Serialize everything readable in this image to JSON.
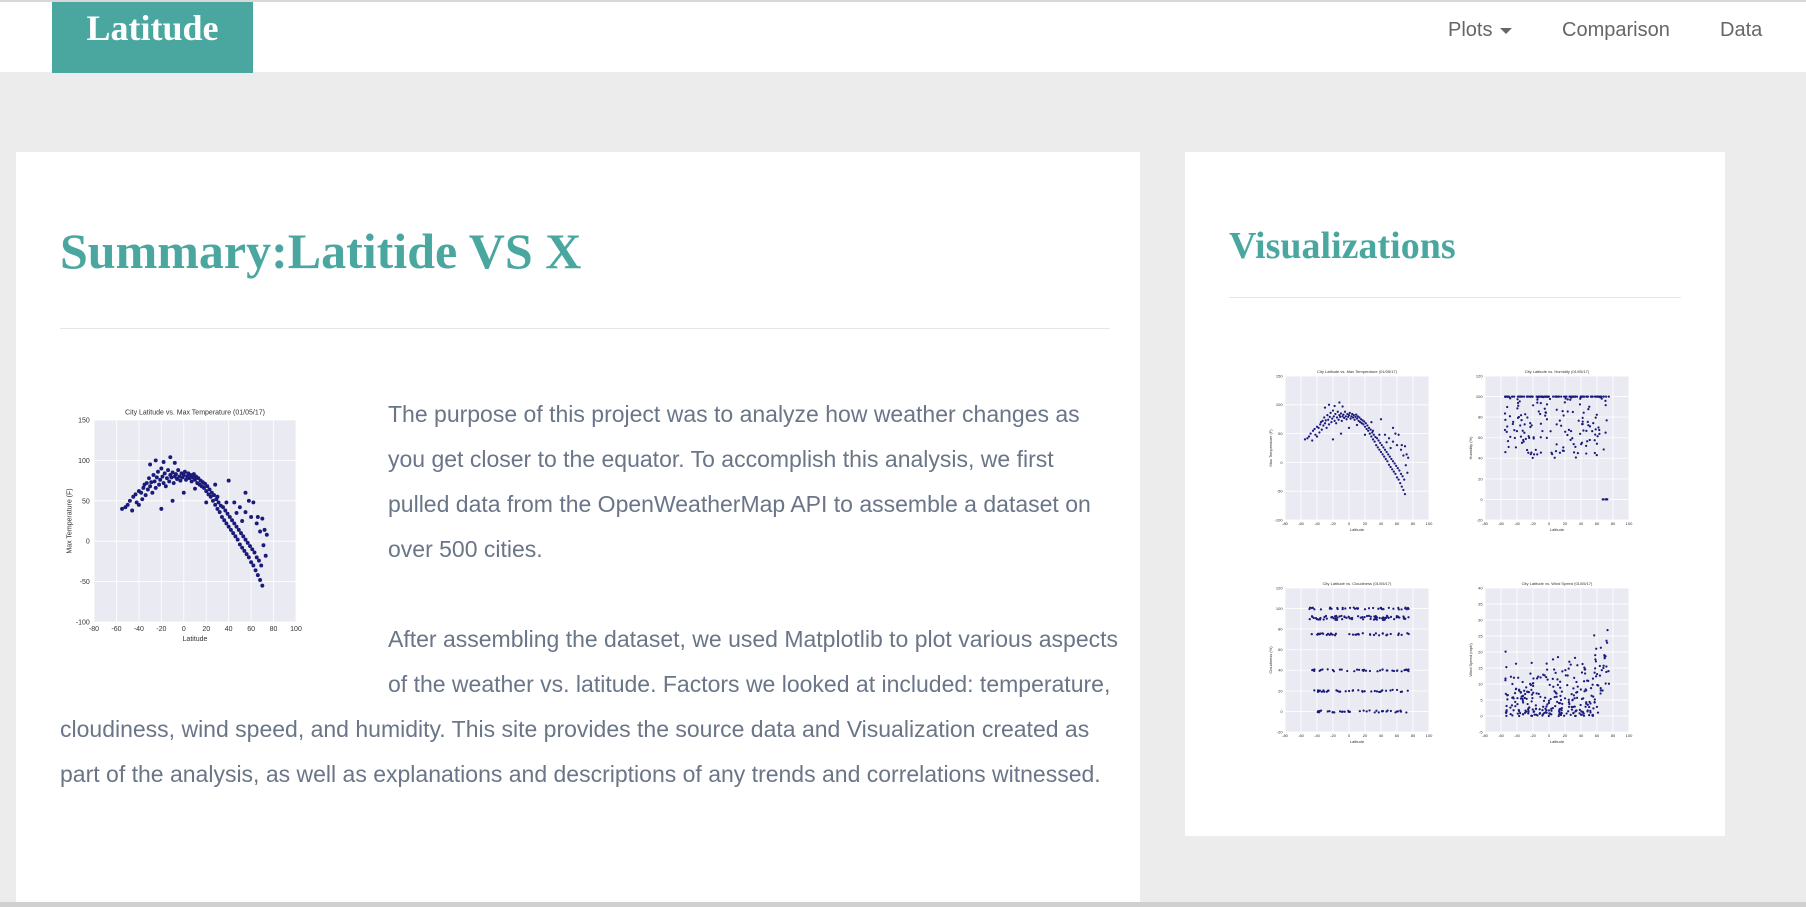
{
  "navbar": {
    "brand": "Latitude",
    "items": [
      {
        "label": "Plots",
        "dropdown": true
      },
      {
        "label": "Comparison"
      },
      {
        "label": "Data"
      }
    ]
  },
  "colors": {
    "accent": "#4aa79f",
    "text": "#6a7587",
    "background": "#ececec",
    "plot_background": "#eaeaf2",
    "point": "#1a1a7a"
  },
  "summary": {
    "title": "Summary:Latitide VS X",
    "paragraph1": "The purpose of this project was to analyze how weather changes as you get closer to the equator. To accomplish this analysis, we first pulled data from the OpenWeatherMap API to assemble a dataset on over 500 cities.",
    "paragraph2": "After assembling the dataset, we used Matplotlib to plot various aspects of the weather vs. latitude. Factors we looked at included: temperature, cloudiness, wind speed, and humidity. This site provides the source data and Visualization created as part of the analysis, as well as explanations and descriptions of any trends and correlations witnessed."
  },
  "sidebar": {
    "title": "Visualizations"
  },
  "chart_data": [
    {
      "type": "scatter",
      "title": "City Latitude vs. Max Temperature (01/05/17)",
      "xlabel": "Latitude",
      "ylabel": "Max Temperature (F)",
      "xlim": [
        -80,
        100
      ],
      "ylim": [
        -100,
        150
      ],
      "xticks": [
        -80,
        -60,
        -40,
        -20,
        0,
        20,
        40,
        60,
        80,
        100
      ],
      "yticks": [
        -100,
        -50,
        0,
        50,
        100,
        150
      ],
      "grid": true,
      "points": [
        [
          -55,
          40
        ],
        [
          -52,
          42
        ],
        [
          -50,
          45
        ],
        [
          -48,
          50
        ],
        [
          -46,
          38
        ],
        [
          -45,
          55
        ],
        [
          -43,
          58
        ],
        [
          -42,
          48
        ],
        [
          -40,
          62
        ],
        [
          -38,
          60
        ],
        [
          -37,
          52
        ],
        [
          -36,
          66
        ],
        [
          -35,
          70
        ],
        [
          -34,
          57
        ],
        [
          -33,
          72
        ],
        [
          -32,
          64
        ],
        [
          -31,
          78
        ],
        [
          -30,
          68
        ],
        [
          -29,
          73
        ],
        [
          -28,
          60
        ],
        [
          -27,
          82
        ],
        [
          -26,
          74
        ],
        [
          -25,
          66
        ],
        [
          -24,
          79
        ],
        [
          -23,
          86
        ],
        [
          -22,
          70
        ],
        [
          -21,
          76
        ],
        [
          -20,
          90
        ],
        [
          -19,
          80
        ],
        [
          -18,
          72
        ],
        [
          -17,
          84
        ],
        [
          -16,
          68
        ],
        [
          -15,
          78
        ],
        [
          -14,
          88
        ],
        [
          -13,
          74
        ],
        [
          -12,
          82
        ],
        [
          -11,
          79
        ],
        [
          -10,
          85
        ],
        [
          -9,
          72
        ],
        [
          -8,
          80
        ],
        [
          -7,
          83
        ],
        [
          -6,
          77
        ],
        [
          -5,
          88
        ],
        [
          -4,
          80
        ],
        [
          -3,
          75
        ],
        [
          -2,
          84
        ],
        [
          -1,
          79
        ],
        [
          0,
          82
        ],
        [
          1,
          86
        ],
        [
          2,
          76
        ],
        [
          3,
          80
        ],
        [
          4,
          84
        ],
        [
          5,
          78
        ],
        [
          6,
          82
        ],
        [
          7,
          74
        ],
        [
          8,
          79
        ],
        [
          9,
          83
        ],
        [
          10,
          76
        ],
        [
          11,
          80
        ],
        [
          12,
          72
        ],
        [
          13,
          78
        ],
        [
          14,
          70
        ],
        [
          15,
          75
        ],
        [
          16,
          68
        ],
        [
          17,
          73
        ],
        [
          18,
          66
        ],
        [
          19,
          71
        ],
        [
          20,
          62
        ],
        [
          21,
          68
        ],
        [
          22,
          58
        ],
        [
          23,
          64
        ],
        [
          24,
          55
        ],
        [
          25,
          60
        ],
        [
          26,
          50
        ],
        [
          27,
          57
        ],
        [
          28,
          45
        ],
        [
          29,
          52
        ],
        [
          30,
          40
        ],
        [
          31,
          48
        ],
        [
          32,
          36
        ],
        [
          33,
          44
        ],
        [
          34,
          30
        ],
        [
          35,
          42
        ],
        [
          36,
          26
        ],
        [
          37,
          38
        ],
        [
          38,
          22
        ],
        [
          39,
          34
        ],
        [
          40,
          18
        ],
        [
          41,
          30
        ],
        [
          42,
          14
        ],
        [
          43,
          26
        ],
        [
          44,
          10
        ],
        [
          45,
          22
        ],
        [
          46,
          6
        ],
        [
          47,
          18
        ],
        [
          48,
          2
        ],
        [
          49,
          14
        ],
        [
          50,
          -4
        ],
        [
          51,
          10
        ],
        [
          52,
          -8
        ],
        [
          53,
          6
        ],
        [
          54,
          -12
        ],
        [
          55,
          2
        ],
        [
          56,
          -16
        ],
        [
          57,
          -2
        ],
        [
          58,
          -20
        ],
        [
          59,
          -6
        ],
        [
          60,
          -26
        ],
        [
          61,
          -10
        ],
        [
          62,
          -30
        ],
        [
          63,
          -14
        ],
        [
          64,
          -36
        ],
        [
          65,
          -20
        ],
        [
          66,
          -42
        ],
        [
          67,
          -24
        ],
        [
          68,
          -48
        ],
        [
          69,
          -30
        ],
        [
          70,
          -55
        ],
        [
          45,
          48
        ],
        [
          50,
          42
        ],
        [
          55,
          36
        ],
        [
          60,
          30
        ],
        [
          65,
          22
        ],
        [
          70,
          28
        ],
        [
          72,
          14
        ],
        [
          74,
          8
        ],
        [
          -40,
          45
        ],
        [
          -30,
          95
        ],
        [
          -25,
          100
        ],
        [
          -18,
          98
        ],
        [
          -12,
          104
        ],
        [
          -8,
          97
        ],
        [
          -20,
          40
        ],
        [
          -10,
          50
        ],
        [
          0,
          60
        ],
        [
          10,
          65
        ],
        [
          20,
          48
        ],
        [
          30,
          55
        ],
        [
          40,
          75
        ],
        [
          55,
          60
        ],
        [
          62,
          48
        ],
        [
          66,
          30
        ],
        [
          68,
          12
        ],
        [
          71,
          -5
        ],
        [
          73,
          -18
        ],
        [
          58,
          50
        ],
        [
          52,
          25
        ],
        [
          47,
          35
        ],
        [
          38,
          48
        ],
        [
          28,
          70
        ]
      ]
    },
    {
      "type": "scatter",
      "title": "City Latitude vs. Max Temperature (01/05/17)",
      "xlabel": "Latitude",
      "ylabel": "Max Temperature (F)",
      "xlim": [
        -80,
        100
      ],
      "ylim": [
        -100,
        150
      ],
      "xticks": [
        -80,
        -60,
        -40,
        -20,
        0,
        20,
        40,
        60,
        80,
        100
      ],
      "yticks": [
        -100,
        -50,
        0,
        50,
        100,
        150
      ]
    },
    {
      "type": "scatter",
      "title": "City Latitude vs. Humidity (01/05/17)",
      "xlabel": "Latitude",
      "ylabel": "Humidity (%)",
      "xlim": [
        -80,
        100
      ],
      "ylim": [
        -20,
        120
      ],
      "xticks": [
        -80,
        -60,
        -40,
        -20,
        0,
        20,
        40,
        60,
        80,
        100
      ],
      "yticks": [
        -20,
        0,
        20,
        40,
        60,
        80,
        100,
        120
      ]
    },
    {
      "type": "scatter",
      "title": "City Latitude vs. Cloudiness (01/05/17)",
      "xlabel": "Latitude",
      "ylabel": "Cloudiness (%)",
      "xlim": [
        -80,
        100
      ],
      "ylim": [
        -20,
        120
      ],
      "xticks": [
        -80,
        -60,
        -40,
        -20,
        0,
        20,
        40,
        60,
        80,
        100
      ],
      "yticks": [
        -20,
        0,
        20,
        40,
        60,
        80,
        100,
        120
      ]
    },
    {
      "type": "scatter",
      "title": "City Latitude vs. Wind Speed (01/05/17)",
      "xlabel": "Latitude",
      "ylabel": "Wind Speed (mph)",
      "xlim": [
        -80,
        100
      ],
      "ylim": [
        -5,
        40
      ],
      "xticks": [
        -80,
        -60,
        -40,
        -20,
        0,
        20,
        40,
        60,
        80,
        100
      ],
      "yticks": [
        -5,
        0,
        5,
        10,
        15,
        20,
        25,
        30,
        35,
        40
      ]
    }
  ]
}
